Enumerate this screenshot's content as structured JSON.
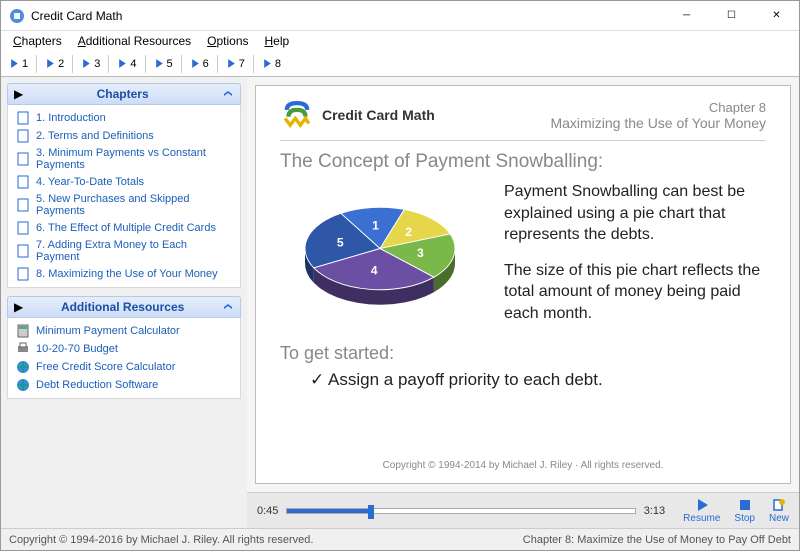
{
  "window": {
    "title": "Credit Card Math"
  },
  "menu": {
    "chapters": "Chapters",
    "resources": "Additional Resources",
    "options": "Options",
    "help": "Help"
  },
  "toolbar": {
    "nums": [
      "1",
      "2",
      "3",
      "4",
      "5",
      "6",
      "7",
      "8"
    ]
  },
  "sidebar": {
    "chapters_hdr": "Chapters",
    "chapters": [
      "1.  Introduction",
      "2.  Terms and Definitions",
      "3.  Minimum Payments vs Constant Payments",
      "4.  Year-To-Date Totals",
      "5.  New Purchases and Skipped Payments",
      "6.  The Effect of Multiple Credit Cards",
      "7.  Adding Extra Money to Each Payment",
      "8.  Maximizing the Use of Your Money"
    ],
    "resources_hdr": "Additional Resources",
    "resources": [
      "Minimum Payment Calculator",
      "10-20-70 Budget",
      "Free Credit Score Calculator",
      "Debt Reduction Software"
    ]
  },
  "slide": {
    "brand": "Credit Card Math",
    "chapter_label": "Chapter 8",
    "chapter_title": "Maximizing  the Use of Your Money",
    "concept": "The Concept of Payment Snowballing:",
    "para1": "Payment Snowballing can best be explained using a pie chart that represents the debts.",
    "para2": "The size of this pie chart reflects the total amount of money being paid each month.",
    "getstarted": "To get started:",
    "bullet": "✓  Assign a payoff priority to each debt.",
    "copyright": "Copyright © 1994-2014  by Michael J. Riley · All rights reserved."
  },
  "player": {
    "elapsed": "0:45",
    "total": "3:13",
    "progress_pct": 24,
    "resume": "Resume",
    "stop": "Stop",
    "new": "New"
  },
  "status": {
    "left": "Copyright © 1994-2016 by Michael J. Riley. All rights reserved.",
    "right": "Chapter 8:  Maximize the Use of Money to Pay Off Debt"
  },
  "chart_data": {
    "type": "pie",
    "title": "",
    "series": [
      {
        "name": "1",
        "value": 14,
        "color": "#3b6fd1"
      },
      {
        "name": "2",
        "value": 14,
        "color": "#e6d74a"
      },
      {
        "name": "3",
        "value": 18,
        "color": "#7bb84a"
      },
      {
        "name": "4",
        "value": 30,
        "color": "#6a4fa3"
      },
      {
        "name": "5",
        "value": 24,
        "color": "#2f57a8"
      }
    ]
  }
}
